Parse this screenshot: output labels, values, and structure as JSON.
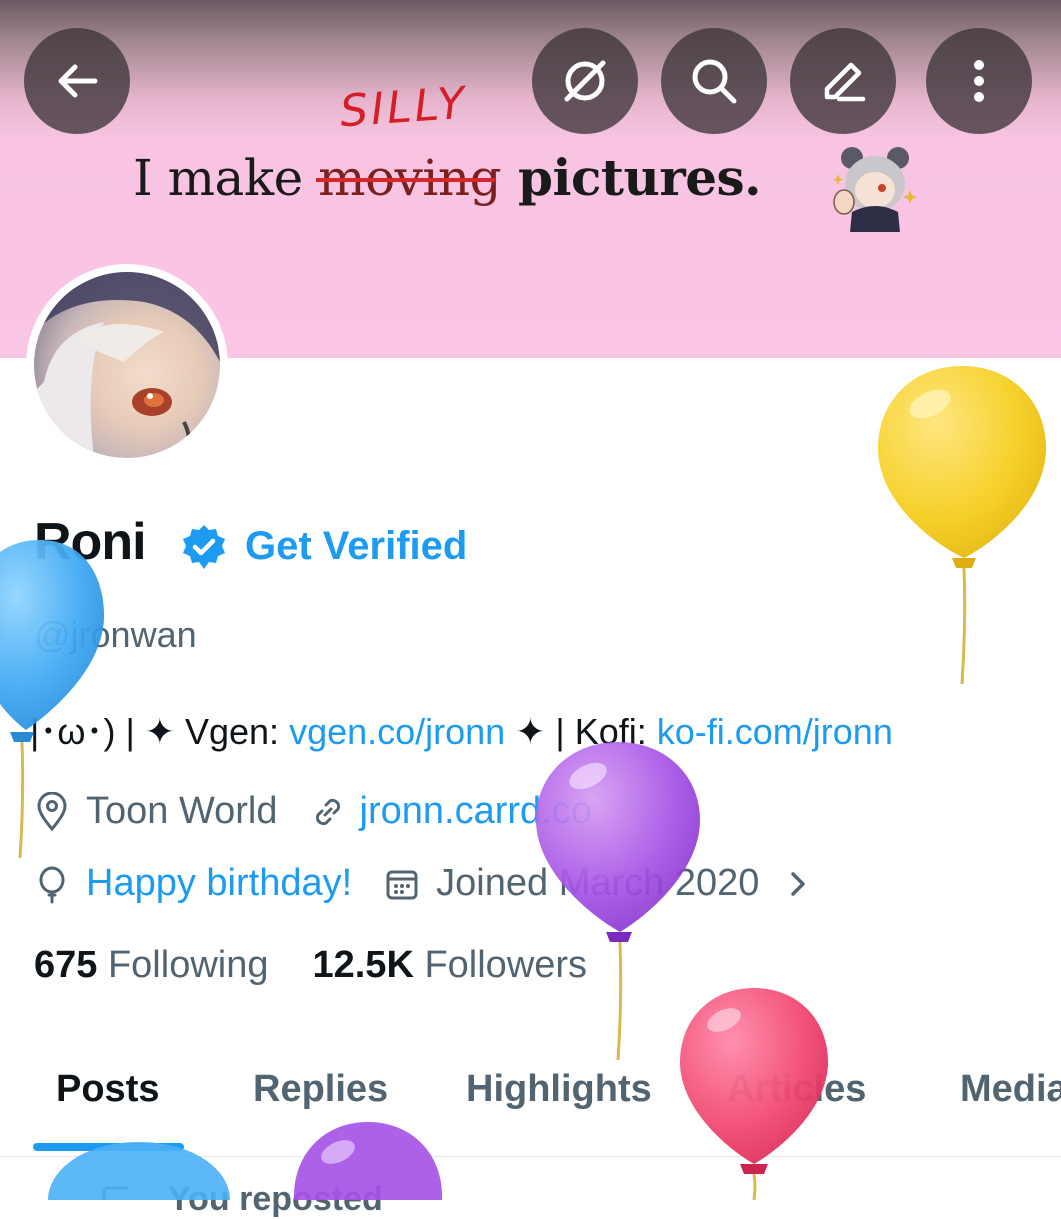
{
  "banner": {
    "tagline_prefix": "I make ",
    "tagline_struck": "moving",
    "tagline_suffix": " pictures.",
    "handwritten_note": "SILLY"
  },
  "top_actions": {
    "back_icon": "arrow-left-icon",
    "grok_icon": "slashed-circle-icon",
    "search_icon": "search-icon",
    "edit_icon": "pencil-icon",
    "more_icon": "more-vertical-icon"
  },
  "profile": {
    "name": "Roni",
    "get_verified_label": "Get Verified",
    "handle": "@jronwan",
    "bio_prefix": "|･ω･) | ✦ Vgen: ",
    "bio_vgen_link": "vgen.co/jronn",
    "bio_middle": " ✦ | Kofi: ",
    "bio_kofi_link": "ko-fi.com/jronn",
    "location": "Toon World",
    "website": "jronn.carrd.co",
    "birthday": "Happy birthday!",
    "joined": "Joined March 2020",
    "following_count": "675",
    "following_label": " Following",
    "followers_count": "12.5K",
    "followers_label": " Followers"
  },
  "tabs": [
    {
      "label": "Posts",
      "active": true
    },
    {
      "label": "Replies"
    },
    {
      "label": "Highlights"
    },
    {
      "label": "Articles"
    },
    {
      "label": "Media"
    }
  ],
  "feed": {
    "repost_notice": "You reposted"
  },
  "colors": {
    "accent": "#1d9bf0",
    "banner_pink": "#fbc5e6",
    "secondary_text": "#536471"
  }
}
